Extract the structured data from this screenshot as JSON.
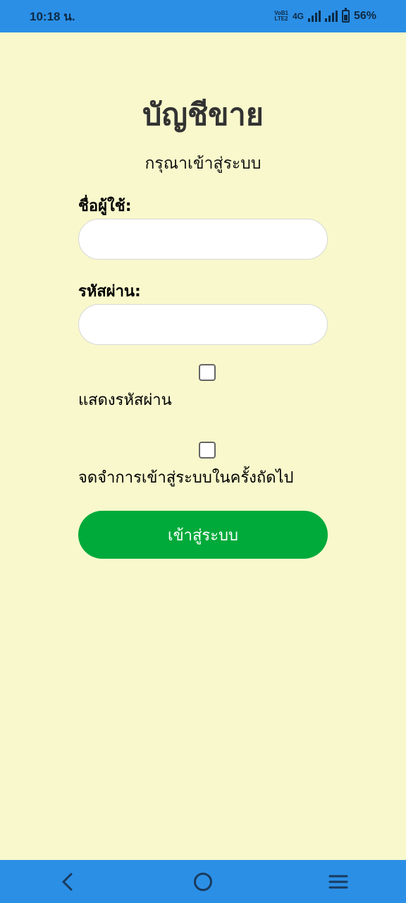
{
  "status_bar": {
    "time": "10:18 น.",
    "volte_top": "VoB1",
    "volte_bottom": "LTE2",
    "network": "4G",
    "battery": "56%",
    "battery_level": 0.56
  },
  "login": {
    "title": "บัญชีขาย",
    "subtitle": "กรุณาเข้าสู่ระบบ",
    "username_label": "ชื่อผู้ใช้:",
    "username_value": "",
    "password_label": "รหัสผ่าน:",
    "password_value": "",
    "show_password_label": "แสดงรหัสผ่าน",
    "remember_label": "จดจำการเข้าสู่ระบบในครั้งถัดไป",
    "submit_label": "เข้าสู่ระบบ"
  },
  "nav": {
    "back_icon": "back-chevron-icon",
    "home_icon": "home-circle-icon",
    "menu_icon": "recent-apps-icon"
  },
  "colors": {
    "status_bar": "#2b8fe6",
    "background": "#f8f8cc",
    "button": "#00aa3a"
  }
}
